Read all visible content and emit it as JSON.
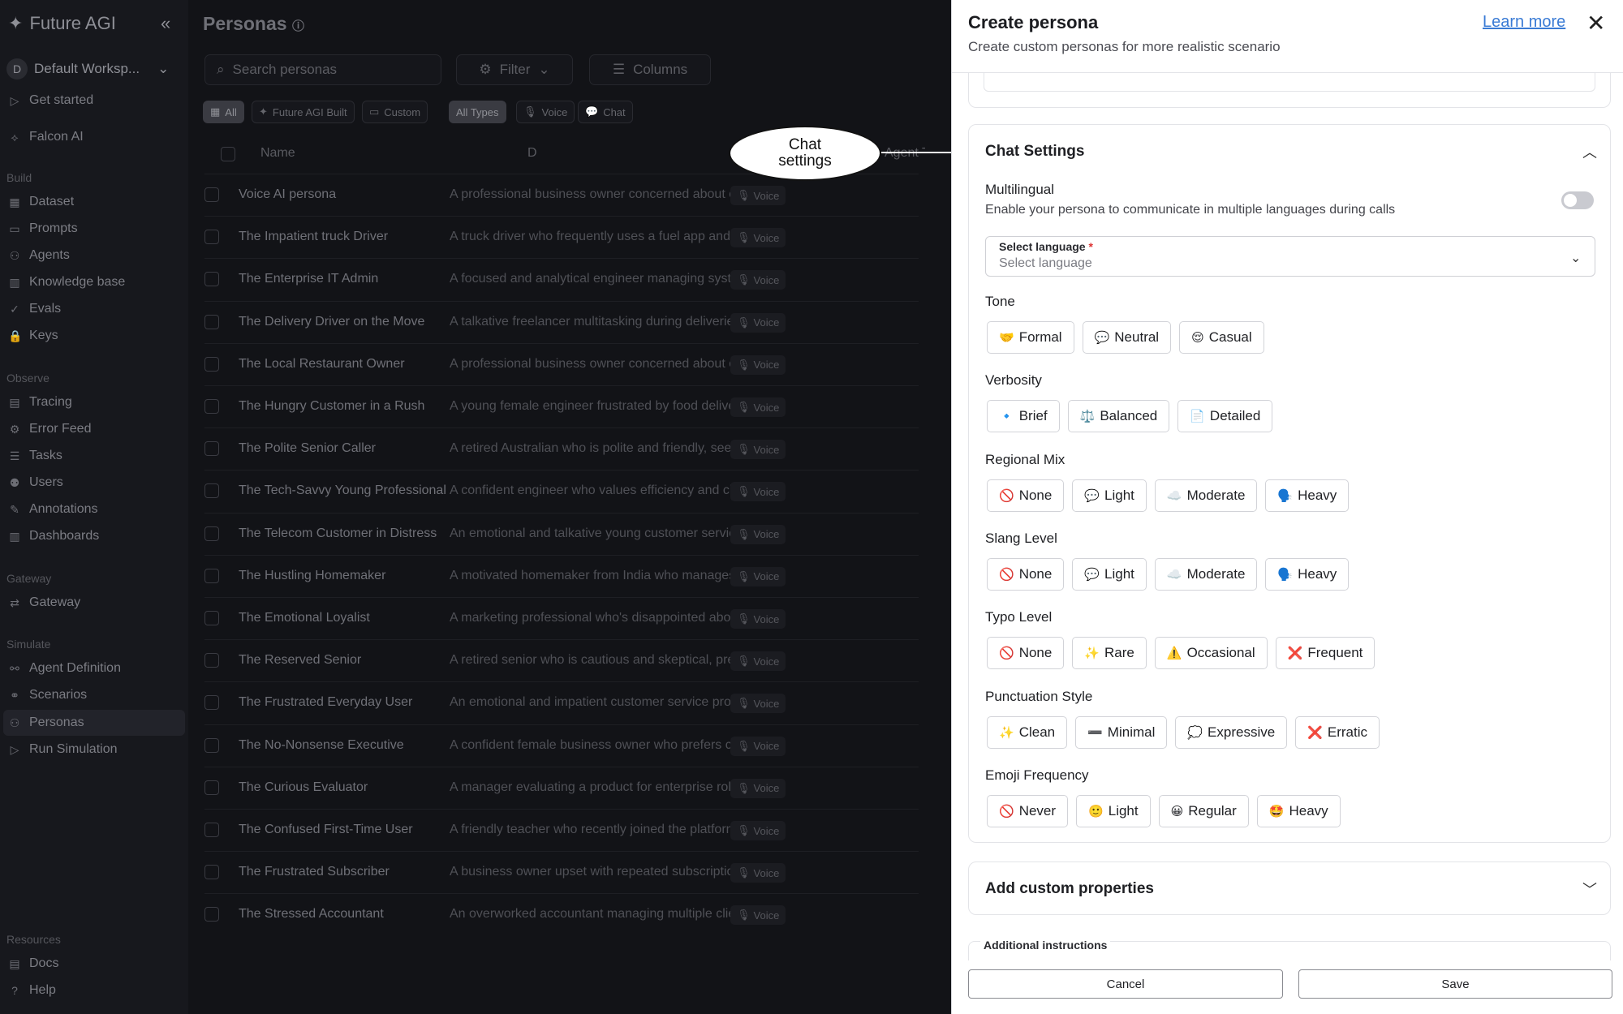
{
  "sidebar": {
    "brand": "Future AGI",
    "workspace_initial": "D",
    "workspace": "Default Worksp...",
    "top_items": [
      "Get started",
      "Falcon AI"
    ],
    "sections": {
      "build": "Build",
      "observe": "Observe",
      "gateway": "Gateway",
      "simulate": "Simulate",
      "resources": "Resources"
    },
    "build_items": [
      "Dataset",
      "Prompts",
      "Agents",
      "Knowledge base",
      "Evals",
      "Keys"
    ],
    "observe_items": [
      "Tracing",
      "Error Feed",
      "Tasks",
      "Users",
      "Annotations",
      "Dashboards"
    ],
    "gateway_items": [
      "Gateway"
    ],
    "simulate_items": [
      "Agent Definition",
      "Scenarios",
      "Personas",
      "Run Simulation"
    ],
    "resources_items": [
      "Docs",
      "Help"
    ],
    "active": "Personas"
  },
  "main": {
    "title": "Personas",
    "search_placeholder": "Search personas",
    "filter_label": "Filter",
    "columns_label": "Columns",
    "source_filters": [
      "All",
      "Future AGI Built",
      "Custom"
    ],
    "type_filters": [
      "All Types",
      "Voice",
      "Chat"
    ],
    "columns": {
      "name": "Name",
      "description": "D",
      "agent_type": "Agent Type"
    },
    "rows": [
      {
        "name": "Voice AI persona",
        "description": "A professional business owner concerned about opera...",
        "type": "Voice"
      },
      {
        "name": "The Impatient truck Driver",
        "description": "A truck driver who frequently uses a fuel app and gets ...",
        "type": "Voice"
      },
      {
        "name": "The Enterprise IT Admin",
        "description": "A focused and analytical engineer managing system re...",
        "type": "Voice"
      },
      {
        "name": "The Delivery Driver on the Move",
        "description": "A talkative freelancer multitasking during deliveries, oc...",
        "type": "Voice"
      },
      {
        "name": "The Local Restaurant Owner",
        "description": "A professional business owner concerned about opera...",
        "type": "Voice"
      },
      {
        "name": "The Hungry Customer in a Rush",
        "description": "A young female engineer frustrated by food delivery d...",
        "type": "Voice"
      },
      {
        "name": "The Polite Senior Caller",
        "description": "A retired Australian who is polite and friendly, seeking ...",
        "type": "Voice"
      },
      {
        "name": "The Tech-Savvy Young Professional",
        "description": "A confident engineer who values efficiency and clear, t...",
        "type": "Voice"
      },
      {
        "name": "The Telecom Customer in Distress",
        "description": "An emotional and talkative young customer service wo...",
        "type": "Voice"
      },
      {
        "name": "The Hustling Homemaker",
        "description": "A motivated homemaker from India who manages famil...",
        "type": "Voice"
      },
      {
        "name": "The Emotional Loyalist",
        "description": "A marketing professional who's disappointed about re...",
        "type": "Voice"
      },
      {
        "name": "The Reserved Senior",
        "description": "A retired senior who is cautious and skeptical, preferri...",
        "type": "Voice"
      },
      {
        "name": "The Frustrated Everyday User",
        "description": "An emotional and impatient customer service professi...",
        "type": "Voice"
      },
      {
        "name": "The No-Nonsense Executive",
        "description": "A confident female business owner who prefers concis...",
        "type": "Voice"
      },
      {
        "name": "The Curious Evaluator",
        "description": "A manager evaluating a product for enterprise rollout, ...",
        "type": "Voice"
      },
      {
        "name": "The Confused First-Time User",
        "description": "A friendly teacher who recently joined the platform an...",
        "type": "Voice"
      },
      {
        "name": "The Frustrated Subscriber",
        "description": "A business owner upset with repeated subscription bill...",
        "type": "Voice"
      },
      {
        "name": "The Stressed Accountant",
        "description": "An overworked accountant managing multiple clients ...",
        "type": "Voice"
      }
    ]
  },
  "annotation": {
    "text": "Chat settings"
  },
  "panel": {
    "title": "Create persona",
    "subtitle": "Create custom personas for more realistic scenario",
    "learn_more": "Learn more",
    "chat_settings": {
      "title": "Chat Settings",
      "multilingual_label": "Multilingual",
      "multilingual_desc": "Enable your persona to communicate in multiple languages during calls",
      "multilingual_on": false,
      "language_label": "Select language",
      "language_required": "*",
      "language_placeholder": "Select language",
      "groups": [
        {
          "label": "Tone",
          "options": [
            {
              "icon": "🤝",
              "text": "Formal"
            },
            {
              "icon": "💬",
              "text": "Neutral"
            },
            {
              "icon": "😌",
              "text": "Casual"
            }
          ]
        },
        {
          "label": "Verbosity",
          "options": [
            {
              "icon": "🔹",
              "text": "Brief"
            },
            {
              "icon": "⚖️",
              "text": "Balanced"
            },
            {
              "icon": "📄",
              "text": "Detailed"
            }
          ]
        },
        {
          "label": "Regional Mix",
          "options": [
            {
              "icon": "🚫",
              "text": "None"
            },
            {
              "icon": "💬",
              "text": "Light"
            },
            {
              "icon": "☁️",
              "text": "Moderate"
            },
            {
              "icon": "🗣️",
              "text": "Heavy"
            }
          ]
        },
        {
          "label": "Slang Level",
          "options": [
            {
              "icon": "🚫",
              "text": "None"
            },
            {
              "icon": "💬",
              "text": "Light"
            },
            {
              "icon": "☁️",
              "text": "Moderate"
            },
            {
              "icon": "🗣️",
              "text": "Heavy"
            }
          ]
        },
        {
          "label": "Typo Level",
          "options": [
            {
              "icon": "🚫",
              "text": "None"
            },
            {
              "icon": "✨",
              "text": "Rare"
            },
            {
              "icon": "⚠️",
              "text": "Occasional"
            },
            {
              "icon": "❌",
              "text": "Frequent"
            }
          ]
        },
        {
          "label": "Punctuation Style",
          "options": [
            {
              "icon": "✨",
              "text": "Clean"
            },
            {
              "icon": "➖",
              "text": "Minimal"
            },
            {
              "icon": "💭",
              "text": "Expressive"
            },
            {
              "icon": "❌",
              "text": "Erratic"
            }
          ]
        },
        {
          "label": "Emoji Frequency",
          "options": [
            {
              "icon": "🚫",
              "text": "Never"
            },
            {
              "icon": "🙂",
              "text": "Light"
            },
            {
              "icon": "😀",
              "text": "Regular"
            },
            {
              "icon": "🤩",
              "text": "Heavy"
            }
          ]
        }
      ]
    },
    "custom_properties": "Add custom properties",
    "additional_instructions": "Additional instructions",
    "cancel": "Cancel",
    "save": "Save"
  }
}
